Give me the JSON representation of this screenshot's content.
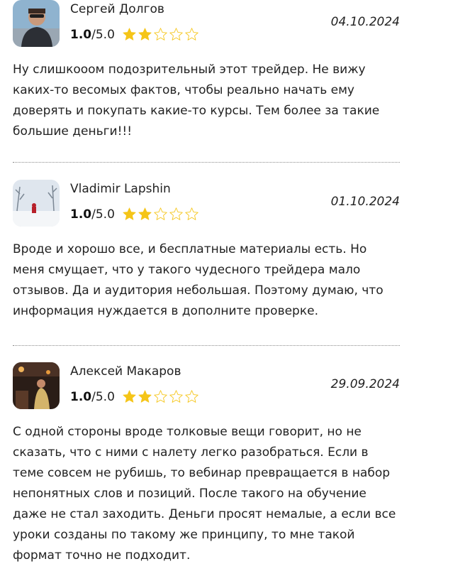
{
  "reviews": [
    {
      "name": "Сергей Долгов",
      "rating_value": "1.0",
      "rating_max": "/5.0",
      "stars_filled": 2,
      "stars_total": 5,
      "date": "04.10.2024",
      "text": "Ну слишкооом подозрительный этот трейдер. Не вижу каких-то весомых фактов, чтобы реально начать ему доверять и покупать какие-то курсы. Тем более за такие большие деньги!!!"
    },
    {
      "name": "Vladimir Lapshin",
      "rating_value": "1.0",
      "rating_max": "/5.0",
      "stars_filled": 2,
      "stars_total": 5,
      "date": "01.10.2024",
      "text": "Вроде и хорошо все, и бесплатные материалы есть. Но меня смущает, что у такого чудесного трейдера мало отзывов. Да и аудитория небольшая. Поэтому думаю, что информация нуждается в дополните проверке."
    },
    {
      "name": "Алексей Макаров",
      "rating_value": "1.0",
      "rating_max": "/5.0",
      "stars_filled": 2,
      "stars_total": 5,
      "date": "29.09.2024",
      "text": "С одной стороны вроде толковые вещи говорит, но не сказать, что с ними с налету легко разобраться. Если в теме совсем не рубишь, то вебинар превращается в набор непонятных слов и позиций. После такого на обучение даже не стал заходить. Деньги просят немалые, а если все уроки созданы по такому же принципу, то мне такой формат точно не подходит."
    }
  ],
  "colors": {
    "star": "#f5c518",
    "divider": "#8a8a8a"
  }
}
